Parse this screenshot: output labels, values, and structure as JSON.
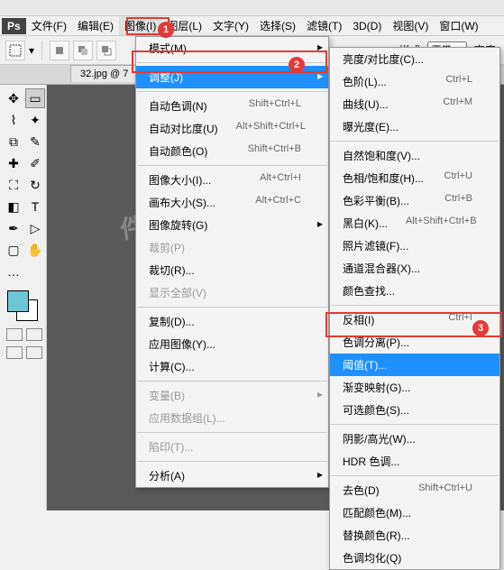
{
  "titlebar": {
    "ps": "Ps"
  },
  "menubar": {
    "file": "文件(F)",
    "edit": "编辑(E)",
    "image": "图像(I)",
    "layer": "图层(L)",
    "type": "文字(Y)",
    "select": "选择(S)",
    "filter": "滤镜(T)",
    "threeD": "3D(D)",
    "view": "视图(V)",
    "window": "窗口(W)"
  },
  "optbar": {
    "style_lbl": "样式:",
    "style_val": "正常",
    "width_lbl": "宽度:"
  },
  "tab": {
    "label": "32.jpg @ 7"
  },
  "watermark": "件自学网\nw.rjzxw.com",
  "menu1": {
    "mode": "模式(M)",
    "adjust": "调整(J)",
    "auto_tone": "自动色调(N)",
    "auto_tone_sc": "Shift+Ctrl+L",
    "auto_contrast": "自动对比度(U)",
    "auto_contrast_sc": "Alt+Shift+Ctrl+L",
    "auto_color": "自动颜色(O)",
    "auto_color_sc": "Shift+Ctrl+B",
    "img_size": "图像大小(I)...",
    "img_size_sc": "Alt+Ctrl+I",
    "canvas_size": "画布大小(S)...",
    "canvas_size_sc": "Alt+Ctrl+C",
    "rotate": "图像旋转(G)",
    "crop": "裁剪(P)",
    "trim": "裁切(R)...",
    "reveal": "显示全部(V)",
    "dup": "复制(D)...",
    "apply_img": "应用图像(Y)...",
    "calc": "计算(C)...",
    "variables": "变量(B)",
    "datasets": "应用数据组(L)...",
    "trap": "陷印(T)...",
    "analysis": "分析(A)"
  },
  "menu2": {
    "brightness": "亮度/对比度(C)...",
    "levels": "色阶(L)...",
    "levels_sc": "Ctrl+L",
    "curves": "曲线(U)...",
    "curves_sc": "Ctrl+M",
    "exposure": "曝光度(E)...",
    "vibrance": "自然饱和度(V)...",
    "hue": "色相/饱和度(H)...",
    "hue_sc": "Ctrl+U",
    "color_balance": "色彩平衡(B)...",
    "color_balance_sc": "Ctrl+B",
    "bw": "黑白(K)...",
    "bw_sc": "Alt+Shift+Ctrl+B",
    "photo_filter": "照片滤镜(F)...",
    "channel_mixer": "通道混合器(X)...",
    "color_lookup": "颜色查找...",
    "invert": "反相(I)",
    "invert_sc": "Ctrl+I",
    "posterize": "色调分离(P)...",
    "threshold": "阈值(T)...",
    "gradient_map": "渐变映射(G)...",
    "selective": "可选颜色(S)...",
    "shadows": "阴影/高光(W)...",
    "hdr": "HDR 色调...",
    "desat": "去色(D)",
    "desat_sc": "Shift+Ctrl+U",
    "match": "匹配颜色(M)...",
    "replace": "替换颜色(R)...",
    "equalize": "色调均化(Q)"
  },
  "annot": {
    "one": "1",
    "two": "2",
    "three": "3"
  }
}
